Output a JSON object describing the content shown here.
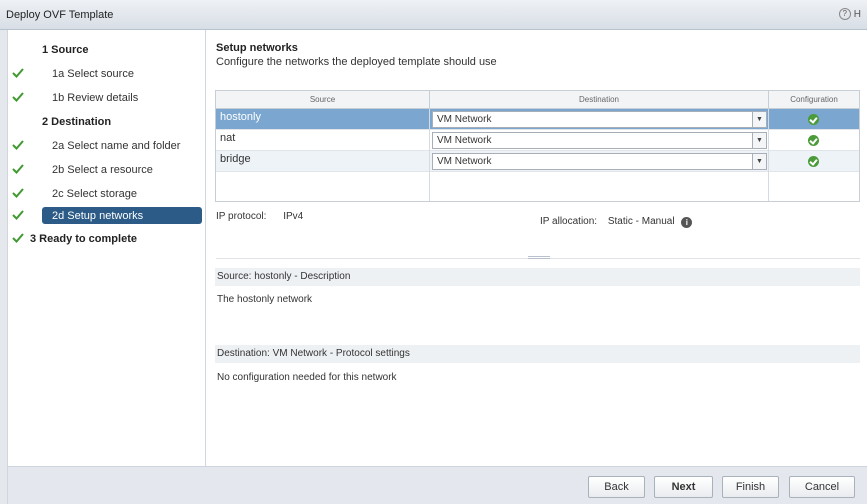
{
  "window": {
    "title": "Deploy OVF Template",
    "help_label": "H"
  },
  "steps": [
    {
      "label": "1 Source",
      "type": "header",
      "done": false
    },
    {
      "label": "1a Select source",
      "type": "sub",
      "done": true
    },
    {
      "label": "1b Review details",
      "type": "sub",
      "done": true
    },
    {
      "label": "2 Destination",
      "type": "header",
      "done": false
    },
    {
      "label": "2a Select name and folder",
      "type": "sub",
      "done": true
    },
    {
      "label": "2b Select a resource",
      "type": "sub",
      "done": true
    },
    {
      "label": "2c Select storage",
      "type": "sub",
      "done": true
    },
    {
      "label": "2d Setup networks",
      "type": "sub",
      "done": true,
      "active": true
    },
    {
      "label": "3 Ready to complete",
      "type": "header",
      "done": true
    }
  ],
  "main": {
    "title": "Setup networks",
    "subtitle": "Configure the networks the deployed template should use",
    "table": {
      "columns": [
        "Source",
        "Destination",
        "Configuration"
      ],
      "rows": [
        {
          "source": "hostonly",
          "destination": "VM Network",
          "status": "ok"
        },
        {
          "source": "nat",
          "destination": "VM Network",
          "status": "ok"
        },
        {
          "source": "bridge",
          "destination": "VM Network",
          "status": "ok"
        }
      ]
    },
    "ip_protocol_label": "IP protocol:",
    "ip_protocol_value": "IPv4",
    "ip_allocation_label": "IP allocation:",
    "ip_allocation_value": "Static - Manual",
    "source_desc_header": "Source: hostonly - Description",
    "source_desc_text": "The hostonly network",
    "dest_header": "Destination: VM Network - Protocol settings",
    "dest_text": "No configuration needed for this network"
  },
  "buttons": {
    "back": "Back",
    "next": "Next",
    "finish": "Finish",
    "cancel": "Cancel"
  },
  "colors": {
    "accent": "#2b5b86",
    "selected_row": "#7aa6cf",
    "ok": "#4b9b3a"
  }
}
